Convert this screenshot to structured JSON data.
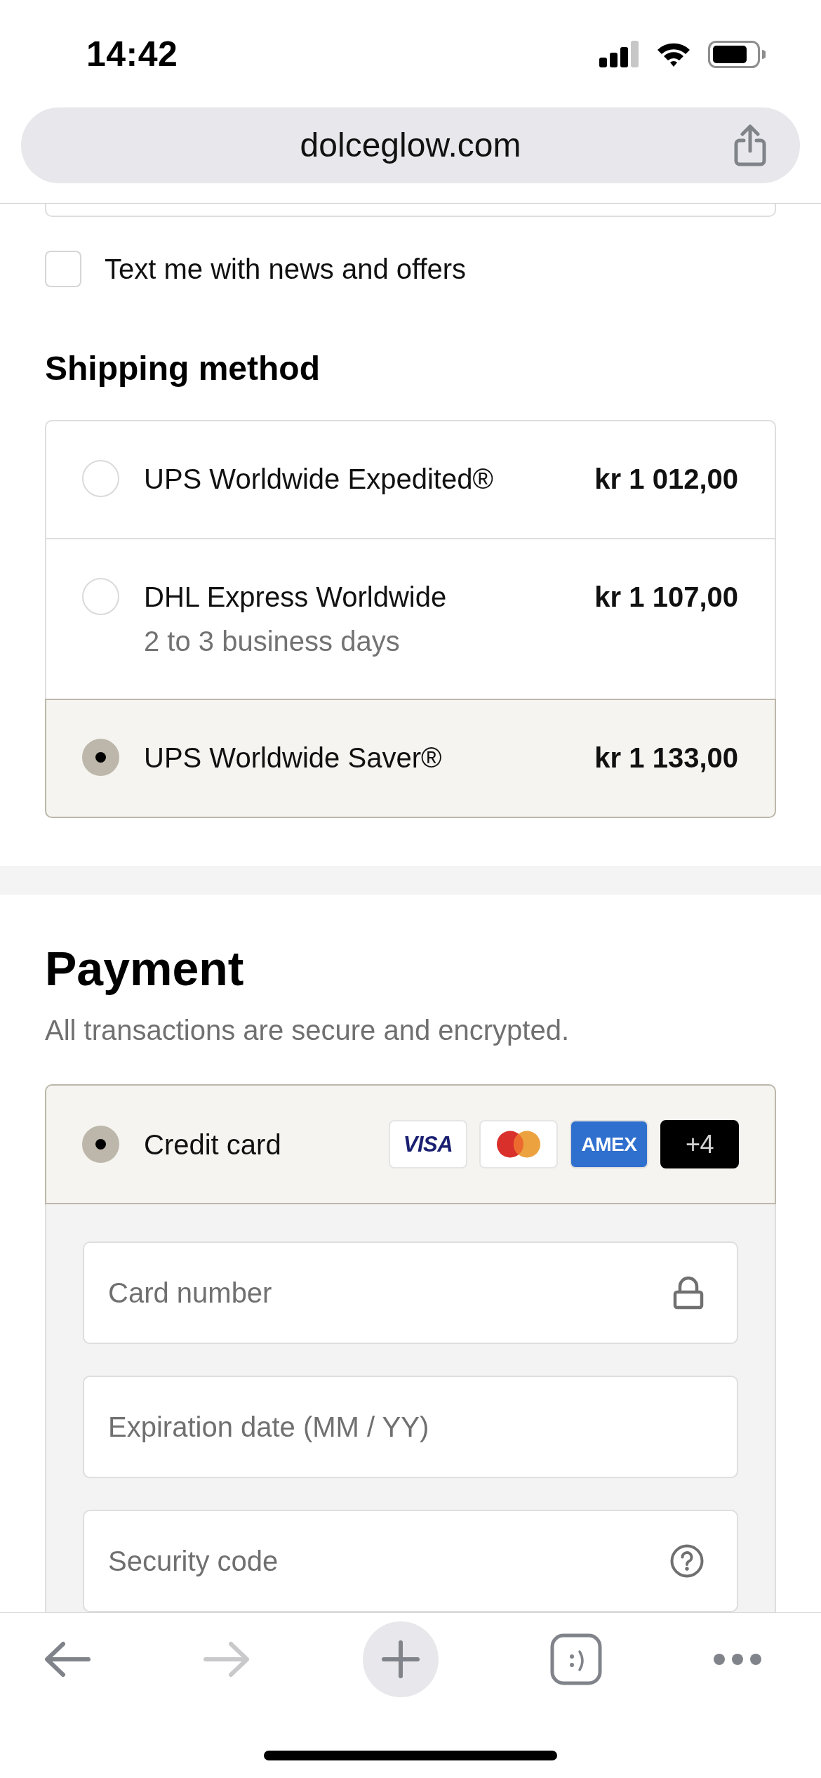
{
  "status_bar": {
    "time": "14:42"
  },
  "address_bar": {
    "url": "dolceglow.com"
  },
  "marketing_opt_in": {
    "label": "Text me with news and offers",
    "checked": false
  },
  "shipping": {
    "title": "Shipping method",
    "options": [
      {
        "name": "UPS Worldwide Expedited®",
        "price": "kr 1 012,00",
        "selected": false
      },
      {
        "name": "DHL Express Worldwide",
        "detail": "2 to 3 business days",
        "price": "kr 1 107,00",
        "selected": false
      },
      {
        "name": "UPS Worldwide Saver®",
        "price": "kr 1 133,00",
        "selected": true
      }
    ]
  },
  "payment": {
    "title": "Payment",
    "subtitle": "All transactions are secure and encrypted.",
    "methods": [
      {
        "name": "Credit card",
        "selected": true,
        "card_brands": [
          {
            "kind": "visa",
            "label": "VISA"
          },
          {
            "kind": "mastercard"
          },
          {
            "kind": "amex",
            "label": "AMEX"
          },
          {
            "kind": "more",
            "label": "+4"
          }
        ],
        "fields": [
          {
            "kind": "lock",
            "placeholder": "Card number"
          },
          {
            "kind": "plain",
            "placeholder": "Expiration date (MM / YY)"
          },
          {
            "kind": "help",
            "placeholder": "Security code"
          }
        ]
      }
    ]
  },
  "toolbar": [
    {
      "kind": "back",
      "disabled": false
    },
    {
      "kind": "forward",
      "disabled": true
    },
    {
      "kind": "new_tab",
      "disabled": false
    },
    {
      "kind": "tabs",
      "disabled": false
    },
    {
      "kind": "more",
      "disabled": false
    }
  ]
}
